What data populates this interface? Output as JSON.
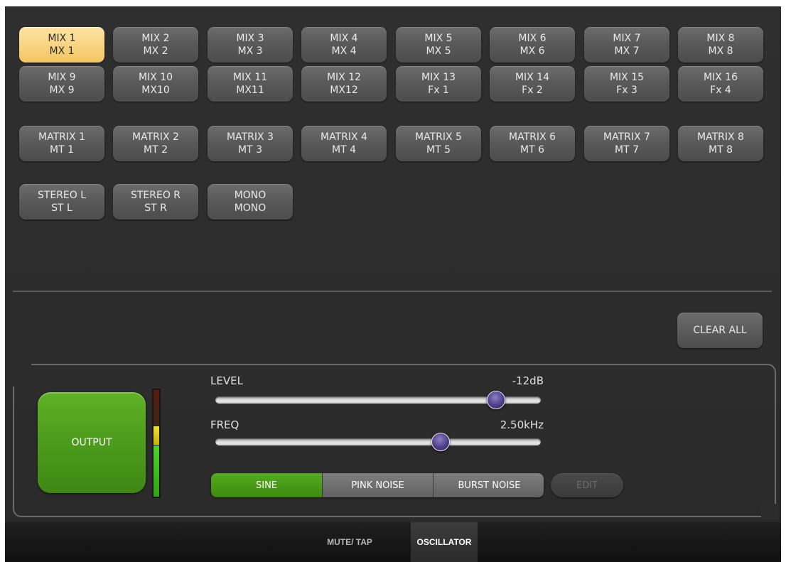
{
  "channels": {
    "mix": [
      {
        "line1": "MIX 1",
        "line2": "MX 1",
        "selected": true
      },
      {
        "line1": "MIX 2",
        "line2": "MX 2"
      },
      {
        "line1": "MIX 3",
        "line2": "MX 3"
      },
      {
        "line1": "MIX 4",
        "line2": "MX 4"
      },
      {
        "line1": "MIX 5",
        "line2": "MX 5"
      },
      {
        "line1": "MIX 6",
        "line2": "MX 6"
      },
      {
        "line1": "MIX 7",
        "line2": "MX 7"
      },
      {
        "line1": "MIX 8",
        "line2": "MX 8"
      },
      {
        "line1": "MIX 9",
        "line2": "MX 9"
      },
      {
        "line1": "MIX 10",
        "line2": "MX10"
      },
      {
        "line1": "MIX 11",
        "line2": "MX11"
      },
      {
        "line1": "MIX 12",
        "line2": "MX12"
      },
      {
        "line1": "MIX 13",
        "line2": "Fx 1"
      },
      {
        "line1": "MIX 14",
        "line2": "Fx 2"
      },
      {
        "line1": "MIX 15",
        "line2": "Fx 3"
      },
      {
        "line1": "MIX 16",
        "line2": "Fx 4"
      }
    ],
    "matrix": [
      {
        "line1": "MATRIX 1",
        "line2": "MT 1"
      },
      {
        "line1": "MATRIX 2",
        "line2": "MT 2"
      },
      {
        "line1": "MATRIX 3",
        "line2": "MT 3"
      },
      {
        "line1": "MATRIX 4",
        "line2": "MT 4"
      },
      {
        "line1": "MATRIX 5",
        "line2": "MT 5"
      },
      {
        "line1": "MATRIX 6",
        "line2": "MT 6"
      },
      {
        "line1": "MATRIX 7",
        "line2": "MT 7"
      },
      {
        "line1": "MATRIX 8",
        "line2": "MT 8"
      }
    ],
    "stereo": [
      {
        "line1": "STEREO L",
        "line2": "ST L"
      },
      {
        "line1": "STEREO R",
        "line2": "ST R"
      },
      {
        "line1": "MONO",
        "line2": "MONO"
      }
    ]
  },
  "clear_all_label": "CLEAR ALL",
  "oscillator": {
    "output_label": "OUTPUT",
    "level_label": "LEVEL",
    "level_value": "-12dB",
    "level_fraction": 0.86,
    "freq_label": "FREQ",
    "freq_value": "2.50kHz",
    "freq_fraction": 0.69,
    "waveforms": [
      "SINE",
      "PINK NOISE",
      "BURST NOISE"
    ],
    "active_waveform": "SINE",
    "edit_label": "EDIT"
  },
  "tabs": [
    {
      "label": "MUTE/ TAP",
      "active": false
    },
    {
      "label": "OSCILLATOR",
      "active": true
    }
  ],
  "colors": {
    "selected_channel": "#f9d583",
    "output_green": "#4c9c1c",
    "knob_purple": "#4e3f8c"
  }
}
